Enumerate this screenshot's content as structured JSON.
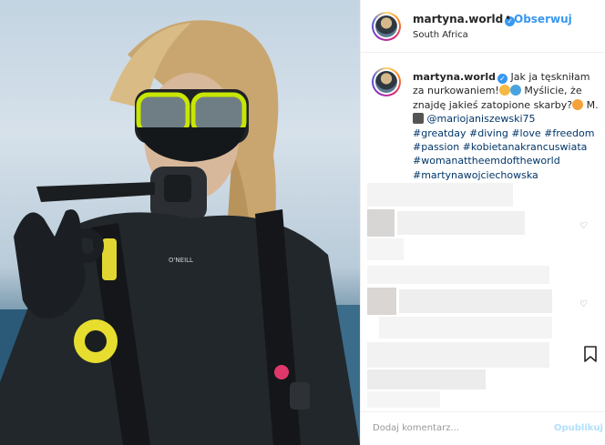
{
  "header": {
    "username": "martyna.world",
    "follow_label": "Obserwuj",
    "location": "South Africa"
  },
  "caption": {
    "username": "martyna.world",
    "text_1": "Jak ja tęskniłam za nurkowaniem!",
    "text_2": "Myślicie, że znajdę jakieś zatopione skarby?",
    "text_3": "M.",
    "mention": "@mariojaniszewski75",
    "hashtags": [
      "#greatday",
      "#diving",
      "#love",
      "#freedom",
      "#passion",
      "#kobietanakrancuswiata",
      "#womanattheemdoftheworld",
      "#martynawojciechowska"
    ]
  },
  "comment_box": {
    "placeholder": "Dodaj komentarz...",
    "publish_label": "Opublikuj"
  },
  "colors": {
    "accent": "#3897f0",
    "hashtag": "#003569",
    "mask_frame": "#c8e600"
  },
  "icons": [
    "verified-badge-icon",
    "heart-icon",
    "bookmark-icon"
  ]
}
